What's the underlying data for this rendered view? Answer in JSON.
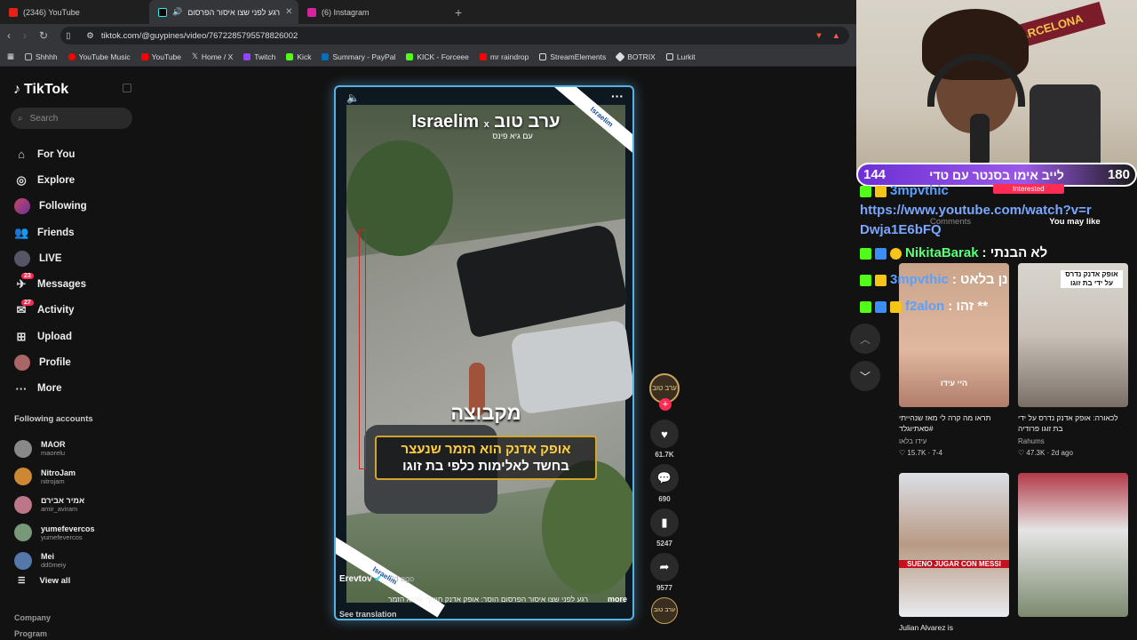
{
  "browser": {
    "tabs": [
      {
        "label": "(2346) YouTube",
        "color": "#e62117"
      },
      {
        "label": "רגע לפני שצו איסור הפרסום",
        "color": "#111111"
      },
      {
        "label": "(6) Instagram",
        "color": "#d6249f"
      }
    ],
    "url": "tiktok.com/@guypines/video/7672285795578826002",
    "bookmarks": [
      "Shhhh",
      "YouTube Music",
      "YouTube",
      "Home / X",
      "Twitch",
      "Kick",
      "Summary - PayPal",
      "KICK - Forceee",
      "mr raindrop",
      "StreamElements",
      "BOTRIX",
      "Lurkit"
    ]
  },
  "tiktok": {
    "logo": "TikTok",
    "search_placeholder": "Search",
    "nav": [
      {
        "label": "For You",
        "icon": "home-icon"
      },
      {
        "label": "Explore",
        "icon": "compass-icon"
      },
      {
        "label": "Following",
        "icon": "avatar-icon"
      },
      {
        "label": "Friends",
        "icon": "friends-icon"
      },
      {
        "label": "LIVE",
        "icon": "live-icon"
      },
      {
        "label": "Messages",
        "icon": "messages-icon",
        "badge": "23"
      },
      {
        "label": "Activity",
        "icon": "activity-icon",
        "badge": "27"
      },
      {
        "label": "Upload",
        "icon": "upload-icon"
      },
      {
        "label": "Profile",
        "icon": "profile-icon"
      },
      {
        "label": "More",
        "icon": "more-icon"
      }
    ],
    "following_header": "Following accounts",
    "accounts": [
      {
        "name": "MAOR",
        "user": "maorelu"
      },
      {
        "name": "NitroJam",
        "user": "nitrojam"
      },
      {
        "name": "אמיר אבירם",
        "user": "amir_aviram"
      },
      {
        "name": "yumefevercos",
        "user": "yumefevercos"
      },
      {
        "name": "Mei",
        "user": "dd0meiy"
      }
    ],
    "view_all": "View all",
    "footer": [
      "Company",
      "Program"
    ]
  },
  "video": {
    "brand_left": "Israelim",
    "brand_x": "x",
    "brand_right": "ערב טוב",
    "brand_sub": "עם גיא פינס",
    "ribbon": "Israelim",
    "headline": "מקבוצה",
    "caption_line1": "אופק אדנק הוא הזמר שנעצר",
    "caption_line2": "בחשד לאלימות כלפי בת זוגו",
    "author": "Erevtov",
    "date": "2d ago",
    "description": "רגע לפני שצו איסור הפרסום הוסר: אופק אדנק חושף שהוא הזמר",
    "more": "more",
    "see_translation": "See translation"
  },
  "rail": {
    "likes": "61.7K",
    "comments": "690",
    "saves": "5247",
    "shares": "9577"
  },
  "right_panel": {
    "tabs": [
      "Comments",
      "You may like"
    ],
    "active_tab": "You may like",
    "cards": [
      {
        "title": "תראו מה קרה לי מאז שנהייתי #סאתיוגלד",
        "author": "עידו בלאו",
        "likes": "15.7K",
        "date": "7-4",
        "tag": "היי עידו"
      },
      {
        "title": "לכאורה: אופק אדנק נדרס על ידי בת זוגו פרודיה",
        "author": "Rahums",
        "likes": "47.3K",
        "date": "2d ago",
        "tag": "אופק אדנק נדרס על ידי בת זוגו"
      },
      {
        "title": "Julian Alvarez is",
        "author": "",
        "likes": "",
        "date": "",
        "tag": "SUENO JUGAR CON MESSI"
      },
      {
        "title": "",
        "author": "",
        "likes": "",
        "date": "",
        "tag": ""
      }
    ]
  },
  "stream_overlay": {
    "poll_left": "144",
    "poll_question": "לייב אימו בסנטר עם טדי",
    "poll_right": "180",
    "flag_text": "FC BARCELONA",
    "tag": "Interested",
    "chat": [
      {
        "user": "3mpvthic",
        "text": ""
      },
      {
        "user": "",
        "text": "https://www.youtube.com/watch?v=rDwja1E6bFQ"
      },
      {
        "user": "NikitaBarak",
        "text": ": לא הבנתי"
      },
      {
        "user": "3mpvthic",
        "text": ": נן בלאט"
      },
      {
        "user": "f2alon",
        "text": ": זהו **"
      }
    ]
  },
  "colors": {
    "accent": "#fe2c55",
    "poll": "#9b59e6",
    "chat_user": "#5aa0ff",
    "video_border": "#5ab0e0"
  }
}
